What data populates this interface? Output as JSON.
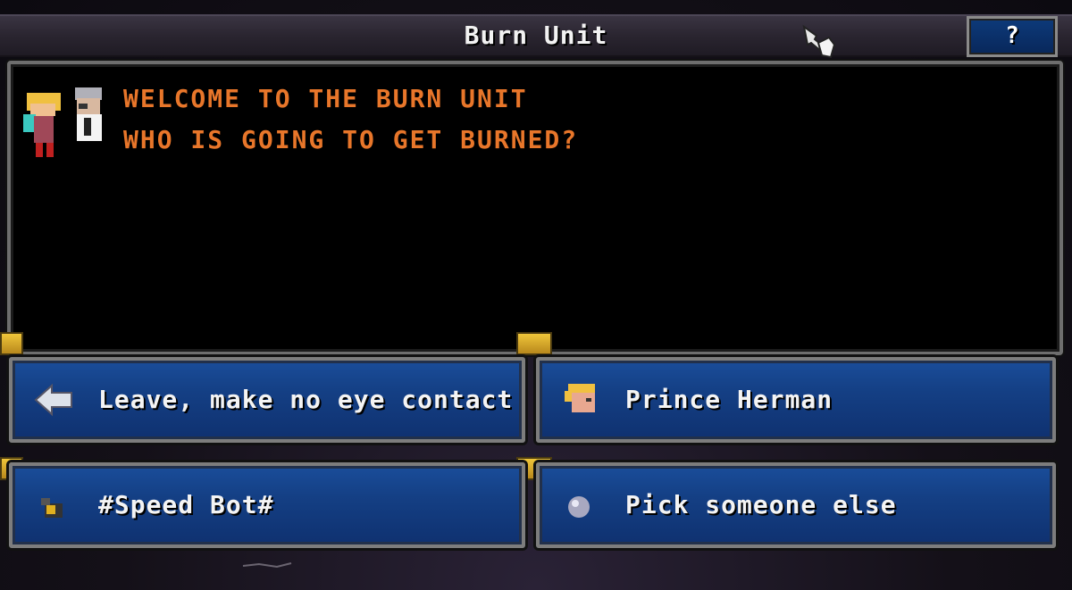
{
  "window": {
    "title": "Burn Unit",
    "help_label": "?"
  },
  "dialog": {
    "lines": [
      "WELCOME TO THE BURN UNIT",
      "WHO IS GOING TO GET BURNED?"
    ],
    "text_color": "#e8762a"
  },
  "choices": [
    {
      "label": "Leave, make no eye contact",
      "icon": "back-arrow-icon"
    },
    {
      "label": "Prince Herman",
      "icon": "prince-herman-face-icon"
    },
    {
      "label": "#Speed Bot#",
      "icon": "speed-bot-icon"
    },
    {
      "label": "Pick someone else",
      "icon": "grey-orb-icon"
    }
  ],
  "colors": {
    "button_blue": "#143f84",
    "frame_grey": "#7d7d7d",
    "clip_gold": "#f0c63a"
  }
}
